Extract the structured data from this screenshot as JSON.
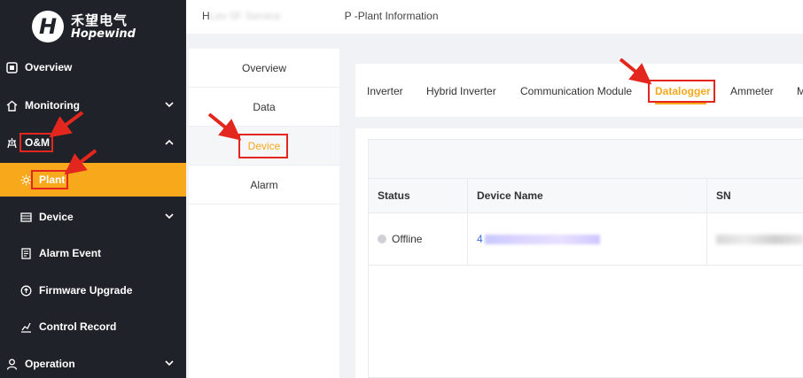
{
  "brand": {
    "mark": "H",
    "name_cn": "禾望电气",
    "name_en": "Hopewind"
  },
  "sidebar": {
    "items": [
      {
        "label": "Overview",
        "icon": "overview-icon"
      },
      {
        "label": "Monitoring",
        "icon": "home-icon"
      },
      {
        "label": "O&M",
        "icon": "tower-icon"
      },
      {
        "label": "Plant",
        "icon": "sun-icon"
      },
      {
        "label": "Device",
        "icon": "list-icon"
      },
      {
        "label": "Alarm Event",
        "icon": "alarm-icon"
      },
      {
        "label": "Firmware Upgrade",
        "icon": "upgrade-icon"
      },
      {
        "label": "Control Record",
        "icon": "record-icon"
      },
      {
        "label": "Operation",
        "icon": "user-icon"
      }
    ]
  },
  "header": {
    "title_prefix": "H",
    "title_partial": "Lev 5F Service",
    "title_suffix": "P -Plant Information"
  },
  "subnav": {
    "tabs": [
      "Overview",
      "Data",
      "Device",
      "Alarm"
    ],
    "active": "Device"
  },
  "device_tabs": {
    "tabs": [
      "Inverter",
      "Hybrid Inverter",
      "Communication Module",
      "Datalogger",
      "Ammeter",
      "M"
    ],
    "active": "Datalogger"
  },
  "table": {
    "headers": [
      "Status",
      "Device Name",
      "SN"
    ],
    "rows": [
      {
        "status": "Offline",
        "device_name_prefix": "4"
      }
    ]
  },
  "colors": {
    "accent": "#f7a81b",
    "sidebar": "#1f2329",
    "highlight": "#e3261e",
    "link": "#3a6cd6"
  }
}
